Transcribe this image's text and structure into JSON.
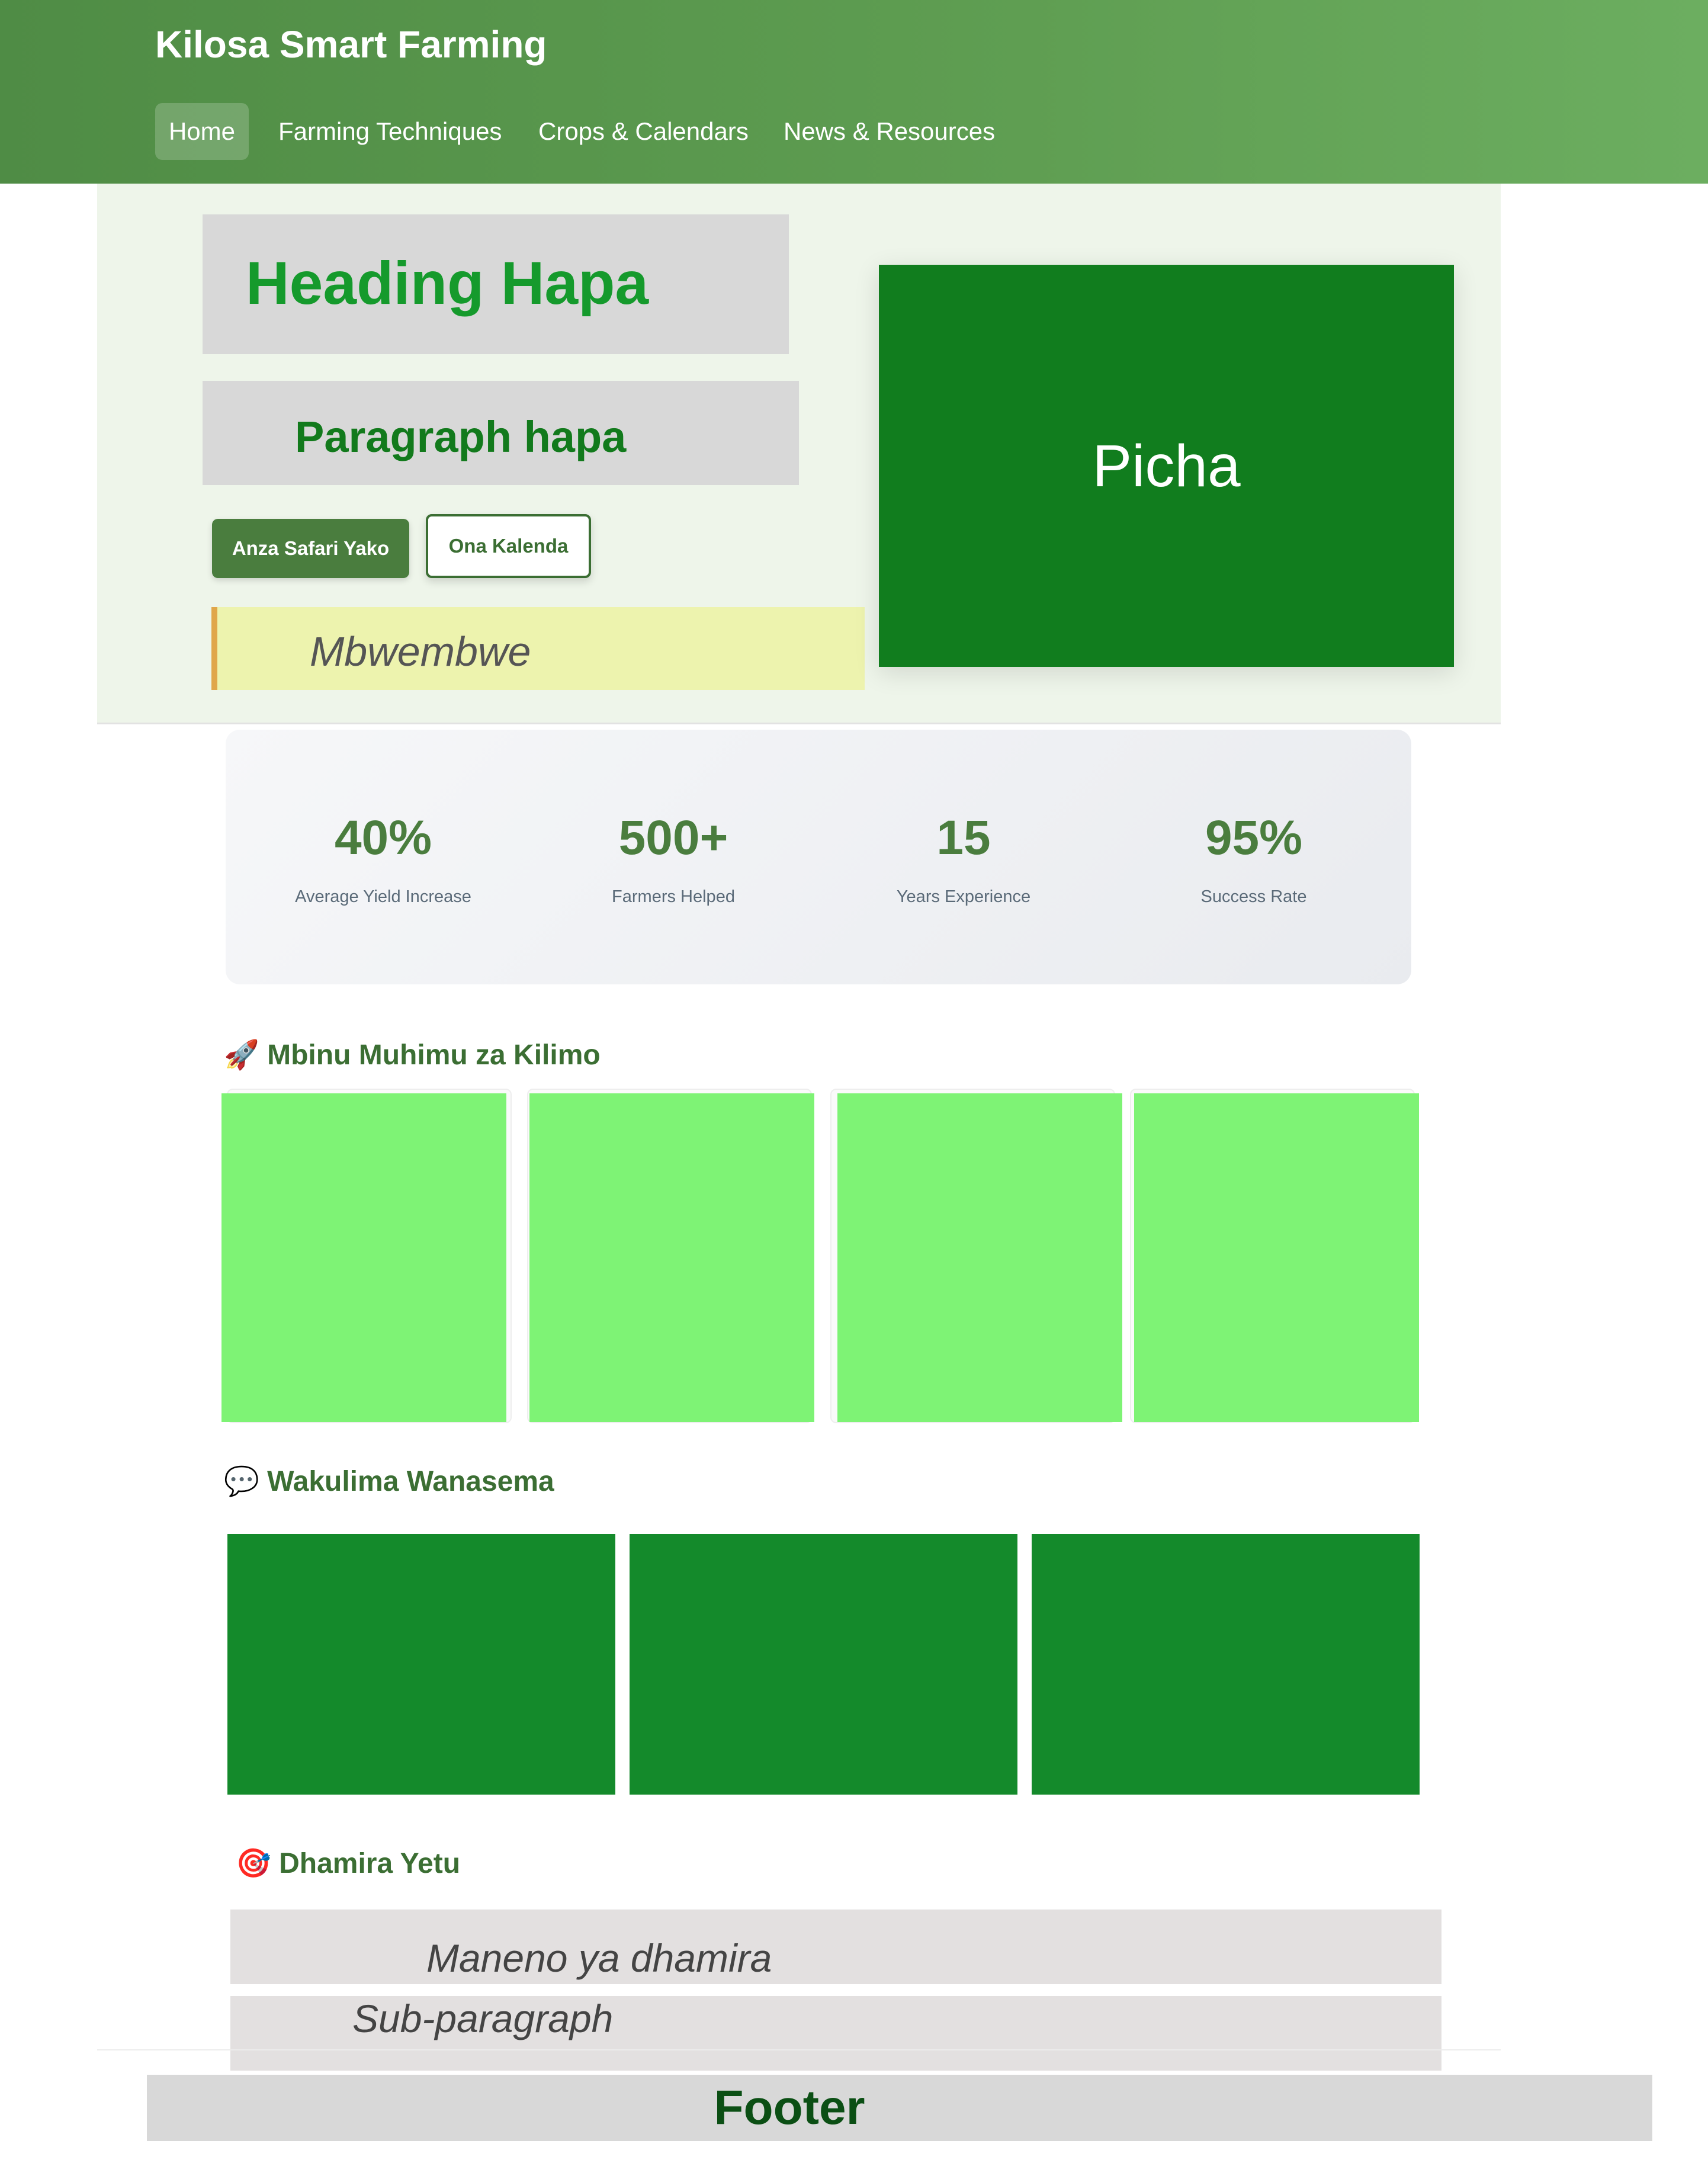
{
  "header": {
    "site_title": "Kilosa Smart Farming",
    "nav": [
      "Home",
      "Farming Techniques",
      "Crops & Calendars",
      "News & Resources"
    ],
    "active_nav": "Home"
  },
  "hero": {
    "heading": "Heading Hapa",
    "paragraph": "Paragraph hapa",
    "primary_button": "Anza Safari Yako",
    "secondary_button": "Ona Kalenda",
    "quote": "Mbwembwe",
    "image_placeholder": "Picha"
  },
  "stats": [
    {
      "value": "40%",
      "label": "Average Yield Increase"
    },
    {
      "value": "500+",
      "label": "Farmers Helped"
    },
    {
      "value": "15",
      "label": "Years Experience"
    },
    {
      "value": "95%",
      "label": "Success Rate"
    }
  ],
  "sections": {
    "features": {
      "icon": "rocket-icon",
      "title": "Mbinu Muhimu za Kilimo"
    },
    "testimonials": {
      "icon": "speech-bubble-icon",
      "title": "Wakulima Wanasema"
    },
    "mission": {
      "icon": "target-icon",
      "title": "Dhamira Yetu",
      "statement": "Maneno ya dhamira",
      "sub_paragraph": "Sub-paragraph"
    }
  },
  "footer": {
    "label": "Footer"
  },
  "colors": {
    "header_green": "#5f9e52",
    "brand_green": "#4a7d3e",
    "hero_image_green": "#117d1e",
    "feature_card_green": "#7ef375",
    "testimonial_green": "#148a2b",
    "quote_bg": "#edf3ae"
  }
}
